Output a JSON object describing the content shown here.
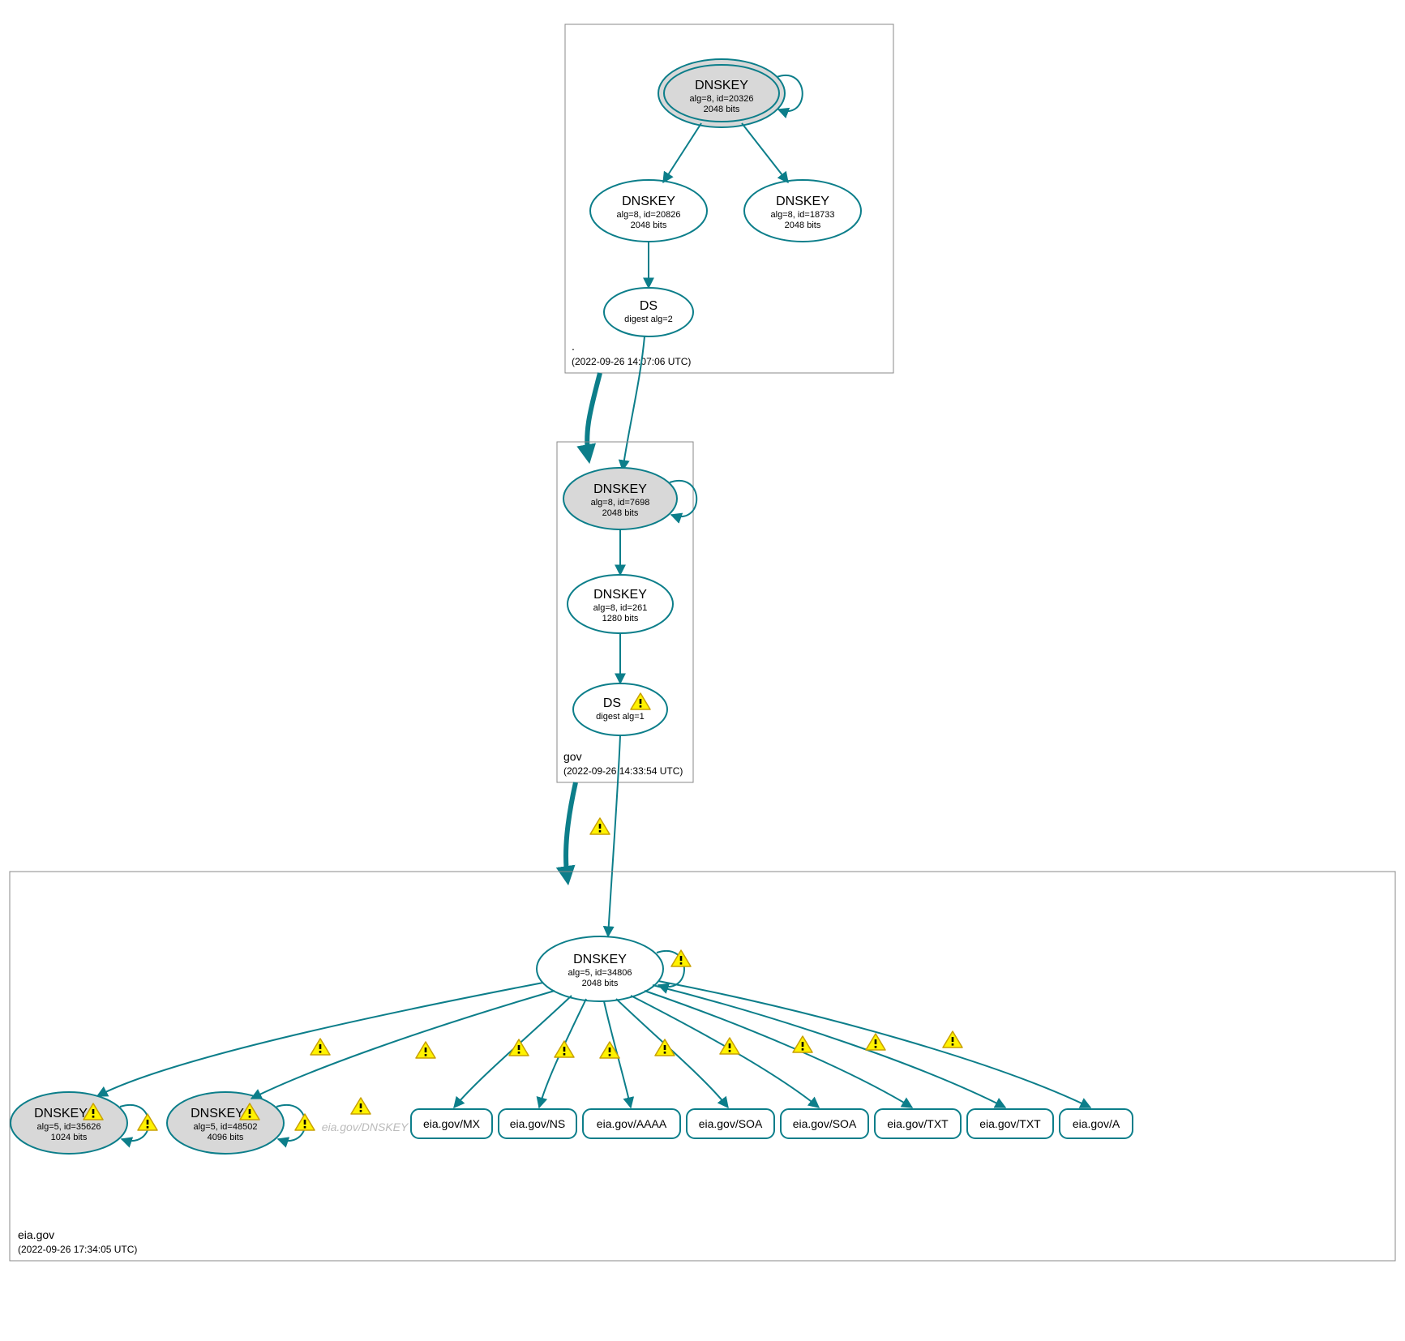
{
  "colors": {
    "secure": "#0c7e8a",
    "ghost": "#bbbbbb",
    "warn_fill": "#fff200",
    "warn_stroke": "#c8a000"
  },
  "zones": {
    "root": {
      "name": ".",
      "timestamp": "(2022-09-26 14:07:06 UTC)",
      "nodes": {
        "ksk": {
          "title": "DNSKEY",
          "sub1": "alg=8, id=20326",
          "sub2": "2048 bits"
        },
        "zsk1": {
          "title": "DNSKEY",
          "sub1": "alg=8, id=20826",
          "sub2": "2048 bits"
        },
        "zsk2": {
          "title": "DNSKEY",
          "sub1": "alg=8, id=18733",
          "sub2": "2048 bits"
        },
        "ds": {
          "title": "DS",
          "sub1": "digest alg=2"
        }
      }
    },
    "gov": {
      "name": "gov",
      "timestamp": "(2022-09-26 14:33:54 UTC)",
      "nodes": {
        "ksk": {
          "title": "DNSKEY",
          "sub1": "alg=8, id=7698",
          "sub2": "2048 bits"
        },
        "zsk": {
          "title": "DNSKEY",
          "sub1": "alg=8, id=261",
          "sub2": "1280 bits"
        },
        "ds": {
          "title": "DS",
          "sub1": "digest alg=1"
        }
      }
    },
    "eiagov": {
      "name": "eia.gov",
      "timestamp": "(2022-09-26 17:34:05 UTC)",
      "nodes": {
        "zsk": {
          "title": "DNSKEY",
          "sub1": "alg=5, id=34806",
          "sub2": "2048 bits"
        },
        "ksk1": {
          "title": "DNSKEY",
          "sub1": "alg=5, id=35626",
          "sub2": "1024 bits"
        },
        "ksk2": {
          "title": "DNSKEY",
          "sub1": "alg=5, id=48502",
          "sub2": "4096 bits"
        },
        "ghost": "eia.gov/DNSKEY"
      },
      "rrsets": [
        "eia.gov/MX",
        "eia.gov/NS",
        "eia.gov/AAAA",
        "eia.gov/SOA",
        "eia.gov/SOA",
        "eia.gov/TXT",
        "eia.gov/TXT",
        "eia.gov/A"
      ]
    }
  }
}
